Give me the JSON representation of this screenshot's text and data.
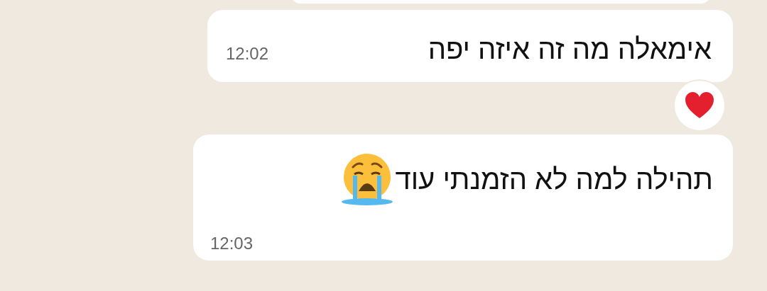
{
  "messages": [
    {
      "kind": "plain",
      "text": "אימאלה מה זה איזה יפה",
      "time": "12:02",
      "reacted": true
    },
    {
      "kind": "emoji",
      "text": "תהילה למה לא הזמנתי עוד",
      "time": "12:03",
      "reacted": false
    }
  ]
}
